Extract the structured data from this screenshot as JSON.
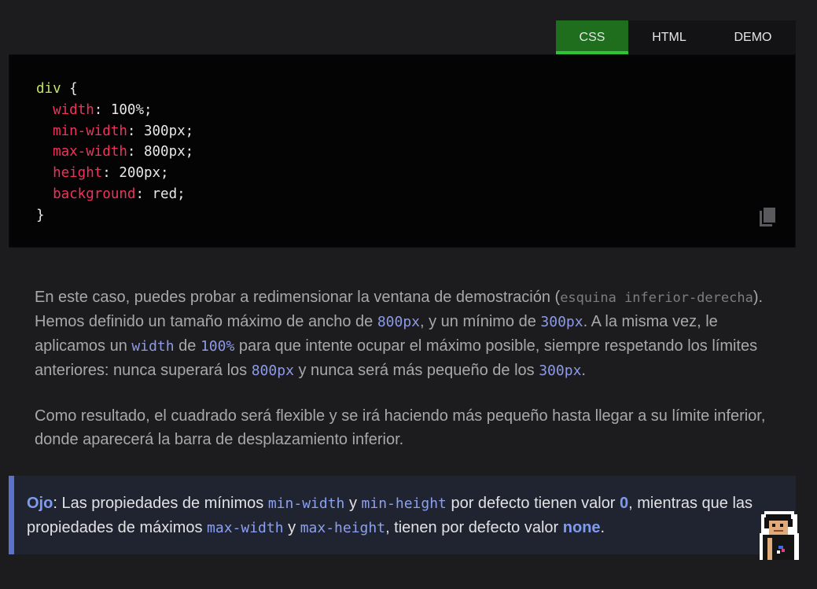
{
  "tabs": [
    {
      "label": "CSS",
      "active": true
    },
    {
      "label": "HTML",
      "active": false
    },
    {
      "label": "DEMO",
      "active": false
    }
  ],
  "code": {
    "selector": "div",
    "open": " {",
    "declarations": [
      {
        "prop": "width",
        "value": "100%;"
      },
      {
        "prop": "min-width",
        "value": "300px;"
      },
      {
        "prop": "max-width",
        "value": "800px;"
      },
      {
        "prop": "height",
        "value": "200px;"
      },
      {
        "prop": "background",
        "value": "red;"
      }
    ],
    "close": "}"
  },
  "paragraph1": {
    "t1": "En este caso, puedes probar a redimensionar la ventana de demostración (",
    "c1": "esquina inferior-derecha",
    "t2": "). Hemos definido un tamaño máximo de ancho de ",
    "c2": "800px",
    "t3": ", y un mínimo de ",
    "c3": "300px",
    "t4": ". A la misma vez, le aplicamos un ",
    "c4": "width",
    "t5": " de ",
    "c5": "100%",
    "t6": " para que intente ocupar el máximo posible, siempre respetando los límites anteriores: nunca superará los ",
    "c6": "800px",
    "t7": " y nunca será más pequeño de los ",
    "c7": "300px",
    "t8": "."
  },
  "paragraph2": "Como resultado, el cuadrado será flexible y se irá haciendo más pequeño hasta llegar a su límite inferior, donde aparecerá la barra de desplazamiento inferior.",
  "note": {
    "title": "Ojo",
    "t1": ": Las propiedades de mínimos ",
    "c1": "min-width",
    "t2": " y ",
    "c2": "min-height",
    "t3": " por defecto tienen valor ",
    "s1": "0",
    "t4": ", mientras que las propiedades de máximos ",
    "c3": "max-width",
    "t5": " y ",
    "c4": "max-height",
    "t6": ", tienen por defecto valor ",
    "s2": "none",
    "t7": "."
  },
  "icons": {
    "copy": "copy-icon",
    "avatar": "pixel-avatar-icon"
  },
  "colors": {
    "active_tab": "#1e6e1e",
    "active_tab_underline": "#2fc33a",
    "css_property": "#f2315a",
    "css_selector": "#c4e55a",
    "inline_code": "#8c9ae8",
    "note_accent": "#5c72c8"
  }
}
